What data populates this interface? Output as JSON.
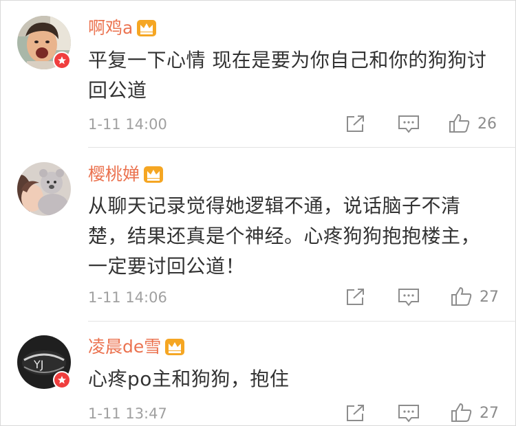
{
  "comments": [
    {
      "username": "啊鸡a",
      "avatar": "child-photo",
      "verified": true,
      "crown_icon": "crown-icon",
      "text": "平复一下心情 现在是要为你自己和你的狗狗讨回公道",
      "time": "1-11 14:00",
      "likes": "26"
    },
    {
      "username": "樱桃婵",
      "avatar": "girl-with-teddy-bear-photo",
      "verified": false,
      "crown_icon": "crown-icon",
      "text": "从聊天记录觉得她逻辑不通，说话脑子不清楚，结果还真是个神经。心疼狗狗抱抱楼主，一定要讨回公道！",
      "time": "1-11 14:06",
      "likes": "27"
    },
    {
      "username": "凌晨de雪",
      "avatar": "dark-logo-photo",
      "verified": true,
      "crown_icon": "crown-icon",
      "text": "心疼po主和狗狗，抱住",
      "time": "1-11 13:47",
      "likes": "27"
    }
  ],
  "icons": {
    "share": "share-icon",
    "comment": "comment-icon",
    "like": "thumbs-up-icon",
    "verified": "verified-badge-icon"
  },
  "colors": {
    "username": "#eb7350",
    "text": "#333333",
    "meta": "#a0a0a0",
    "icon": "#8c8c8c",
    "badge": "#f03e3e",
    "crown": "#f5a623"
  }
}
